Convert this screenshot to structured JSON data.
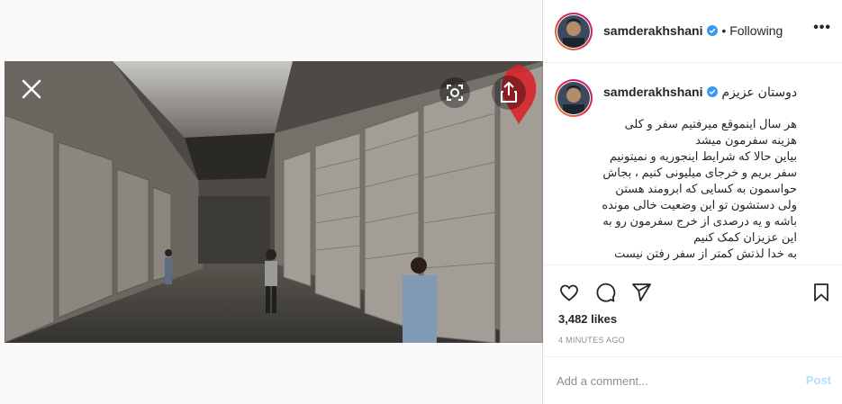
{
  "post": {
    "username": "samderakhshani",
    "follow_status": "• Following",
    "more_label": "•••",
    "caption_title": "دوستان عزیزم",
    "caption_body": "هر سال اینموقع میرفتیم سفر و کلی\nهزینه سفرمون میشد\nبیاین حالا که شرایط اینجوریه و نمیتونیم\nسفر بریم و خرجای میلیونی کنیم ، بجاش\nحواسمون به کسایی که ابرومند هستن\nولی دستشون تو این وضعیت خالی مونده\nباشه و یه درصدی از خرج سفرمون رو به\nاین عزیزان کمک کنیم\nبه خدا لذتش کمتر از سفر رفتن نیست",
    "likes": "3,482 likes",
    "time": "4 MINUTES AGO"
  },
  "comment": {
    "placeholder": "Add a comment...",
    "post_label": "Post"
  },
  "colors": {
    "accent": "#0095f6",
    "post_disabled": "#b2dffc",
    "verified": "#3897f0"
  },
  "icons": [
    "close-icon",
    "lens-icon",
    "share-icon",
    "heart-icon",
    "comment-icon",
    "send-icon",
    "bookmark-icon",
    "verified-icon"
  ]
}
